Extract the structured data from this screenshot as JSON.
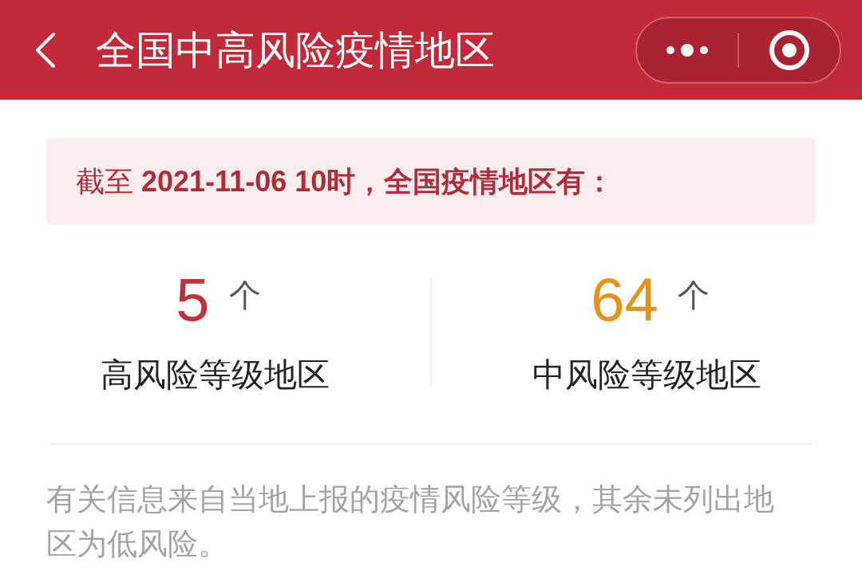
{
  "nav_bar": {
    "title": "全国中高风险疫情地区"
  },
  "banner": {
    "text": "截至 **2021-11-06 10时，全国疫情地区有：**"
  },
  "stats": [
    {
      "count": "5",
      "unit": "个",
      "label": "高风险等级地区",
      "color": "#c0313c"
    },
    {
      "count": "64",
      "unit": "个",
      "label": "中风险等级地区",
      "color": "#e8921e"
    }
  ],
  "note": "有关信息来自当地上报的疫情风险等级，其余未列出地区为低风险。"
}
